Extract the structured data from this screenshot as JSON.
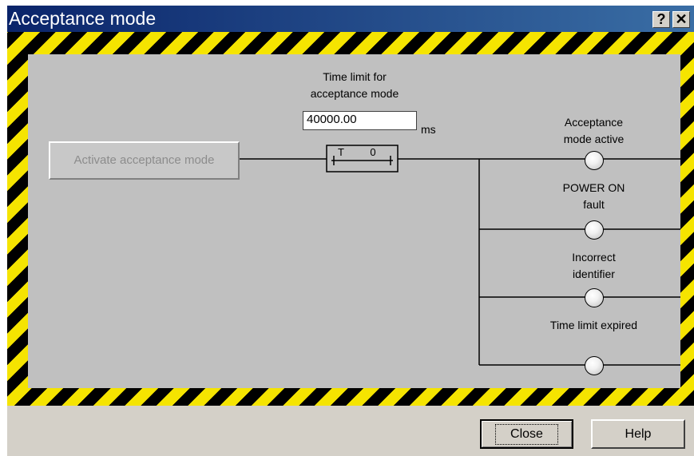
{
  "window": {
    "title": "Acceptance mode",
    "help_icon_label": "?",
    "close_icon_label": "✕"
  },
  "diagram": {
    "activate_button_label": "Activate acceptance mode",
    "time_limit_label_line1": "Time limit for",
    "time_limit_label_line2": "acceptance mode",
    "time_limit_value": "40000.00",
    "time_limit_unit": "ms",
    "timer_label_t": "T",
    "timer_label_0": "0",
    "outputs": [
      {
        "line1": "Acceptance",
        "line2": "mode active"
      },
      {
        "line1": "POWER ON",
        "line2": "fault"
      },
      {
        "line1": "Incorrect",
        "line2": "identifier"
      },
      {
        "line1": "Time limit expired",
        "line2": ""
      }
    ]
  },
  "footer": {
    "close_label": "Close",
    "help_label": "Help"
  }
}
